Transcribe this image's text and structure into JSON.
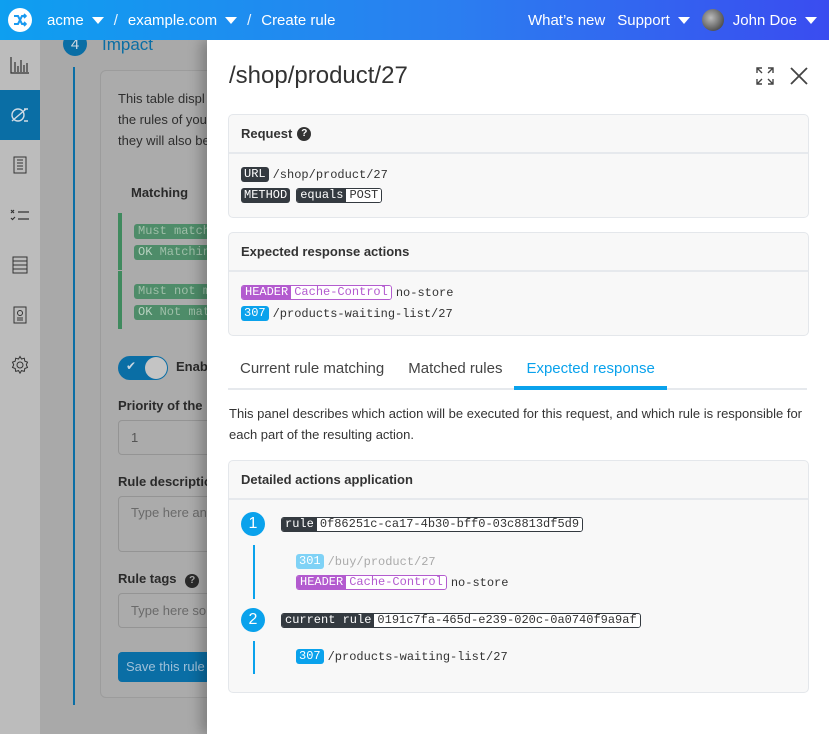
{
  "topbar": {
    "org": "acme",
    "domain": "example.com",
    "page": "Create rule",
    "whats_new": "What’s new",
    "support": "Support",
    "user": "John Doe",
    "separator": "/"
  },
  "sidebar": {
    "items": [
      {
        "icon": "bar-chart-icon",
        "active": false
      },
      {
        "icon": "rules-icon",
        "active": true
      },
      {
        "icon": "document-list-icon",
        "active": false
      },
      {
        "icon": "checklist-icon",
        "active": false
      },
      {
        "icon": "server-icon",
        "active": false
      },
      {
        "icon": "certificate-icon",
        "active": false
      },
      {
        "icon": "gear-icon",
        "active": false
      }
    ]
  },
  "background": {
    "step_number": "4",
    "step_title": "Impact",
    "intro_lines": [
      "This table displ",
      "the rules of you",
      "they will also be"
    ],
    "matching_header": "Matching",
    "match_rows": [
      {
        "badge": "Must match",
        "ok": "OK",
        "value": "Matchin"
      },
      {
        "badge": "Must not m",
        "ok": "OK",
        "value": "Not mat"
      }
    ],
    "enable_label": "Enab",
    "priority_label": "Priority of the r",
    "priority_value": "1",
    "description_label": "Rule descriptio",
    "description_placeholder": "Type here an",
    "tags_label": "Rule tags",
    "tags_placeholder": "Type here so",
    "save_button": "Save this rule"
  },
  "drawer": {
    "title": "/shop/product/27",
    "request": {
      "title": "Request",
      "url_label": "URL",
      "url_value": "/shop/product/27",
      "method_label": "METHOD",
      "operator": "equals",
      "method_value": "POST"
    },
    "expected_actions": {
      "title": "Expected response actions",
      "header_label": "HEADER",
      "header_name": "Cache-Control",
      "header_value": "no-store",
      "status_code": "307",
      "redirect_target": "/products-waiting-list/27"
    },
    "tabs": [
      {
        "label": "Current rule matching",
        "active": false
      },
      {
        "label": "Matched rules",
        "active": false
      },
      {
        "label": "Expected response",
        "active": true
      }
    ],
    "description": "This panel describes which action will be executed for this request, and which rule is responsible for each part of the resulting action.",
    "detailed": {
      "title": "Detailed actions application",
      "steps": [
        {
          "number": "1",
          "rule_label": "rule",
          "rule_id": "0f86251c-ca17-4b30-bff0-03c8813df5d9",
          "status_code": "301",
          "redirect_target": "/buy/product/27",
          "header_label": "HEADER",
          "header_name": "Cache-Control",
          "header_value": "no-store"
        },
        {
          "number": "2",
          "rule_label": "current rule",
          "rule_id": "0191c7fa-465d-e239-020c-0a0740f9a9af",
          "status_code": "307",
          "redirect_target": "/products-waiting-list/27"
        }
      ]
    }
  },
  "colors": {
    "accent": "#0aa2ec",
    "header_badge": "#b35bcf",
    "dark_badge": "#343a40"
  }
}
